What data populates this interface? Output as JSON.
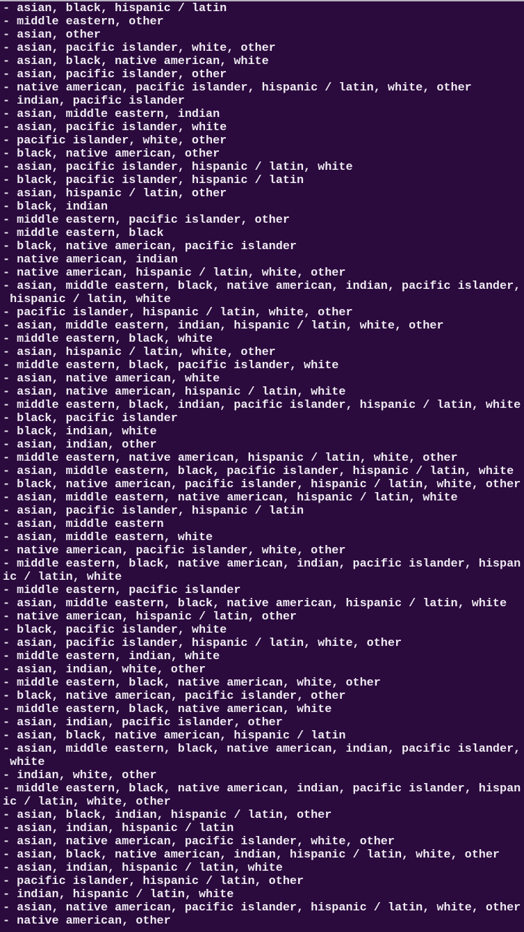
{
  "terminal": {
    "wrap_columns": 74,
    "colors": {
      "background": "#2b0a3d",
      "text": "#eeeaf2"
    },
    "lines": [
      "- asian, black, hispanic / latin",
      "- middle eastern, other",
      "- asian, other",
      "- asian, pacific islander, white, other",
      "- asian, black, native american, white",
      "- asian, pacific islander, other",
      "- native american, pacific islander, hispanic / latin, white, other",
      "- indian, pacific islander",
      "- asian, middle eastern, indian",
      "- asian, pacific islander, white",
      "- pacific islander, white, other",
      "- black, native american, other",
      "- asian, pacific islander, hispanic / latin, white",
      "- black, pacific islander, hispanic / latin",
      "- asian, hispanic / latin, other",
      "- black, indian",
      "- middle eastern, pacific islander, other",
      "- middle eastern, black",
      "- black, native american, pacific islander",
      "- native american, indian",
      "- native american, hispanic / latin, white, other",
      "- asian, middle eastern, black, native american, indian, pacific islander, hispanic / latin, white",
      "- pacific islander, hispanic / latin, white, other",
      "- asian, middle eastern, indian, hispanic / latin, white, other",
      "- middle eastern, black, white",
      "- asian, hispanic / latin, white, other",
      "- middle eastern, black, pacific islander, white",
      "- asian, native american, white",
      "- asian, native american, hispanic / latin, white",
      "- middle eastern, black, indian, pacific islander, hispanic / latin, white",
      "- black, pacific islander",
      "- black, indian, white",
      "- asian, indian, other",
      "- middle eastern, native american, hispanic / latin, white, other",
      "- asian, middle eastern, black, pacific islander, hispanic / latin, white",
      "- black, native american, pacific islander, hispanic / latin, white, other",
      "- asian, middle eastern, native american, hispanic / latin, white",
      "- asian, pacific islander, hispanic / latin",
      "- asian, middle eastern",
      "- asian, middle eastern, white",
      "- native american, pacific islander, white, other",
      "- middle eastern, black, native american, indian, pacific islander, hispanic / latin, white",
      "- middle eastern, pacific islander",
      "- asian, middle eastern, black, native american, hispanic / latin, white",
      "- native american, hispanic / latin, other",
      "- black, pacific islander, white",
      "- asian, pacific islander, hispanic / latin, white, other",
      "- middle eastern, indian, white",
      "- asian, indian, white, other",
      "- middle eastern, black, native american, white, other",
      "- black, native american, pacific islander, other",
      "- middle eastern, black, native american, white",
      "- asian, indian, pacific islander, other",
      "- asian, black, native american, hispanic / latin",
      "- asian, middle eastern, black, native american, indian, pacific islander, white",
      "- indian, white, other",
      "- middle eastern, black, native american, indian, pacific islander, hispanic / latin, white, other",
      "- asian, black, indian, hispanic / latin, other",
      "- asian, indian, hispanic / latin",
      "- asian, native american, pacific islander, white, other",
      "- asian, black, native american, indian, hispanic / latin, white, other",
      "- asian, indian, hispanic / latin, white",
      "- pacific islander, hispanic / latin, other",
      "- indian, hispanic / latin, white",
      "- asian, native american, pacific islander, hispanic / latin, white, other",
      "- native american, other"
    ]
  }
}
